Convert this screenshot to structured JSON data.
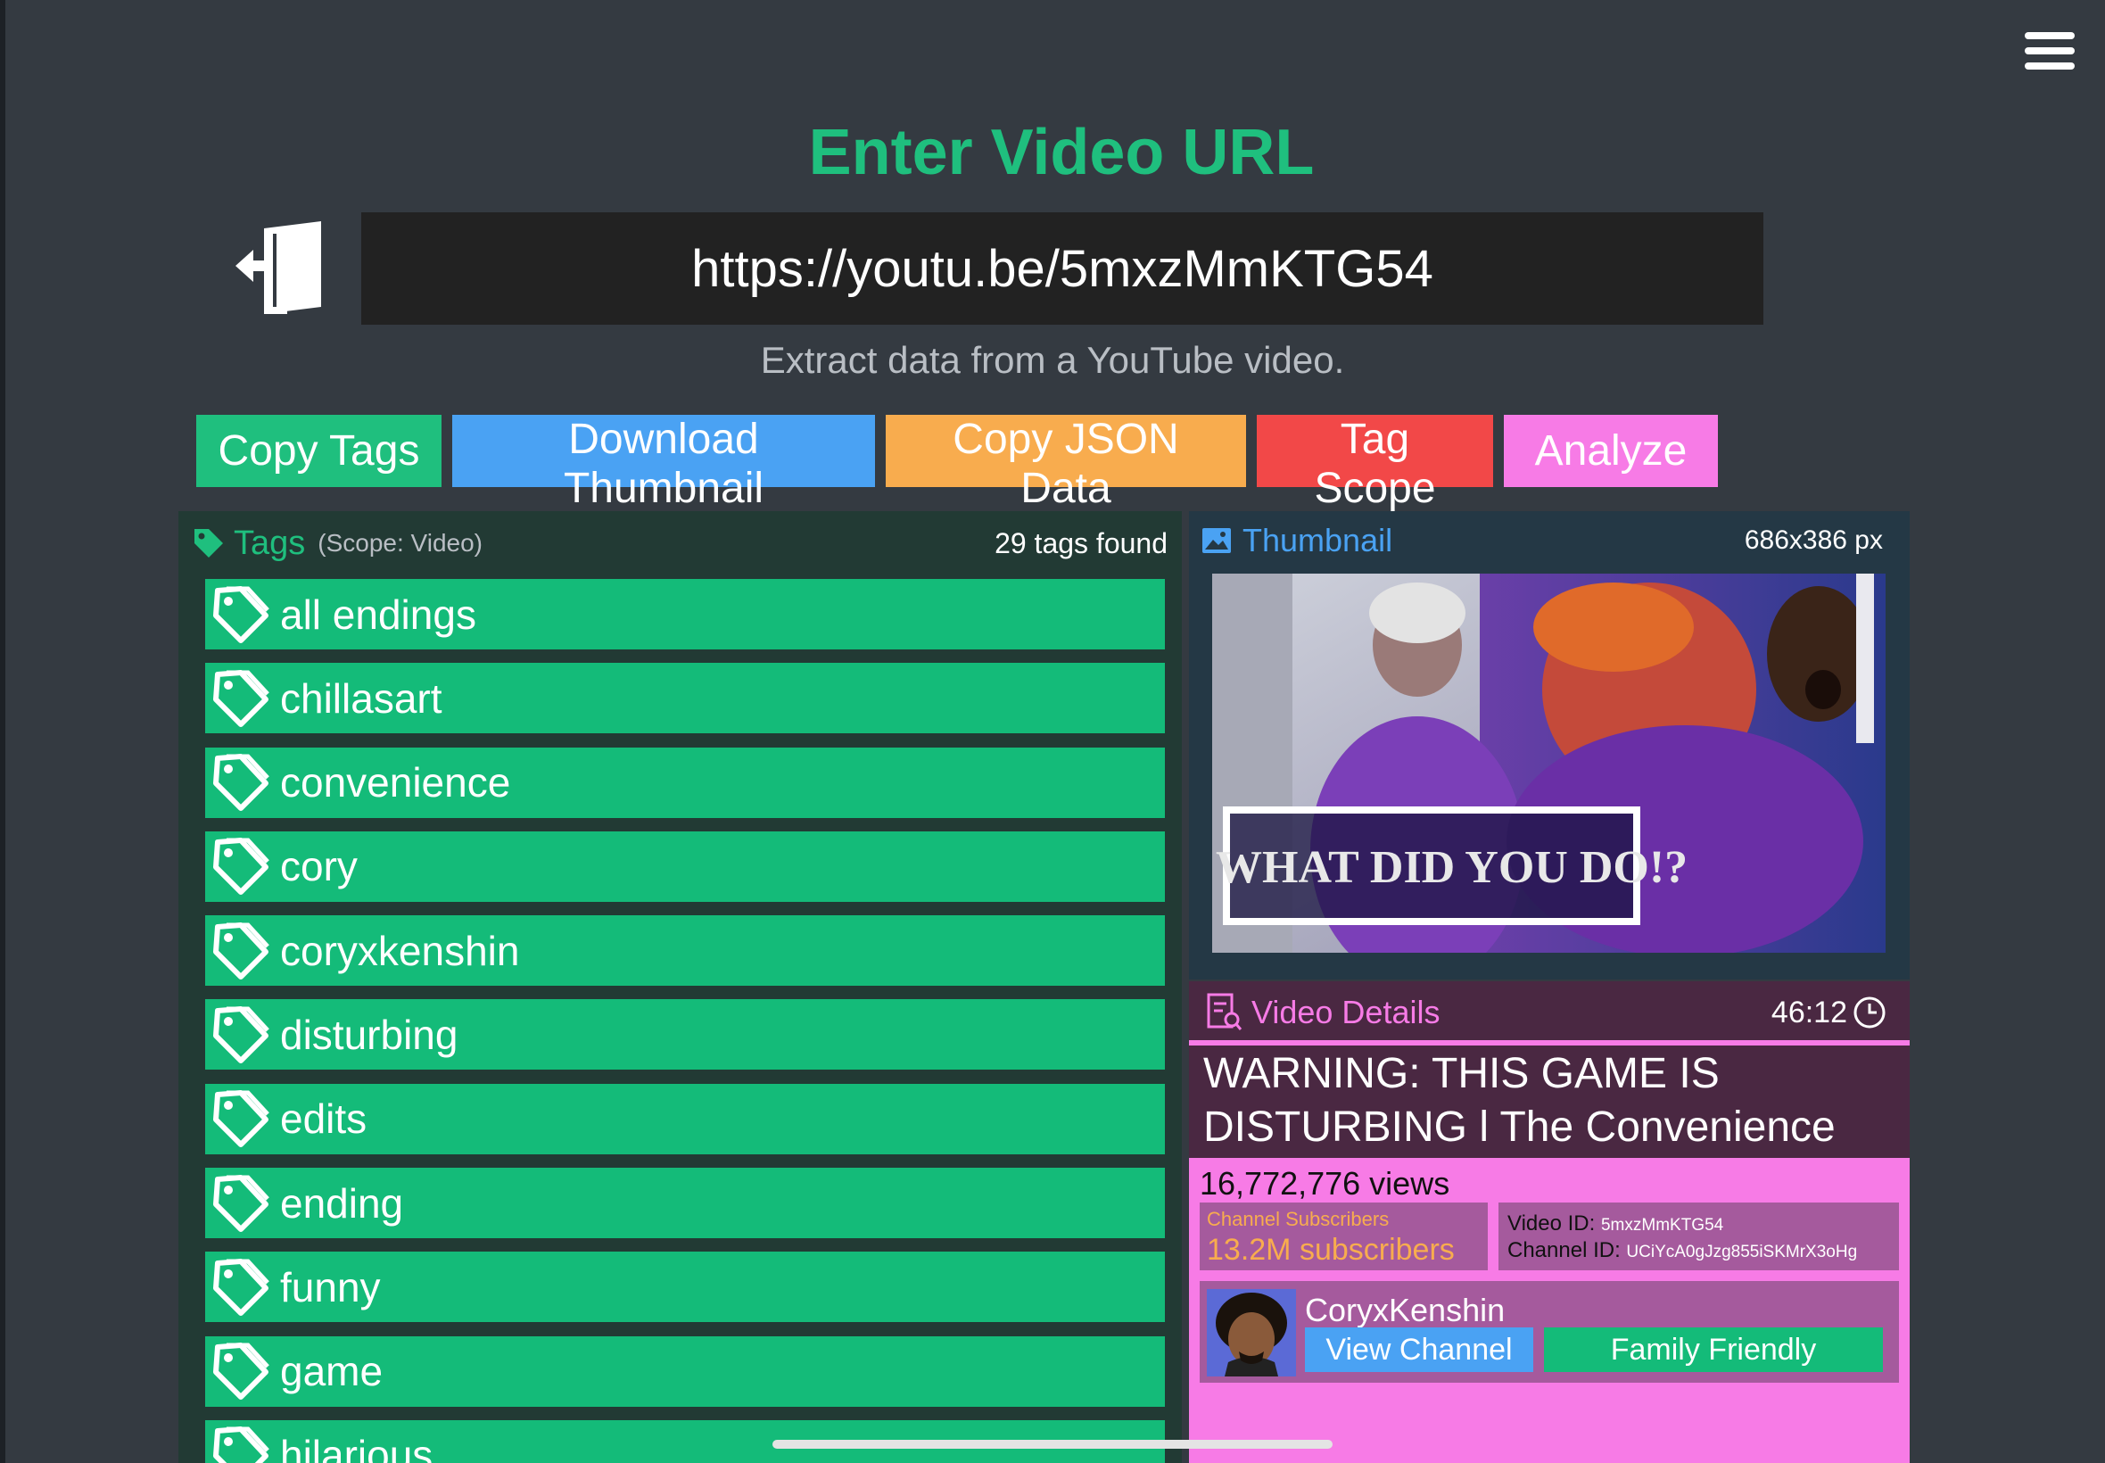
{
  "heading": "Enter Video URL",
  "url_input": {
    "value": "https://youtu.be/5mxzMmKTG54"
  },
  "subtitle": "Extract data from a YouTube video.",
  "buttons": {
    "copy_tags": "Copy Tags",
    "download_thumbnail": "Download Thumbnail",
    "copy_json": "Copy JSON Data",
    "tag_scope": "Tag Scope",
    "analyze": "Analyze"
  },
  "tags_panel": {
    "title": "Tags",
    "scope": "(Scope: Video)",
    "count": "29 tags found",
    "tags": [
      "all endings",
      "chillasart",
      "convenience",
      "cory",
      "coryxkenshin",
      "disturbing",
      "edits",
      "ending",
      "funny",
      "game",
      "hilarious"
    ]
  },
  "thumbnail_panel": {
    "title": "Thumbnail",
    "size": "686x386 px",
    "overlay_text": "WHAT DID YOU DO!?"
  },
  "details_panel": {
    "title": "Video Details",
    "duration": "46:12",
    "video_title": "WARNING: THIS GAME IS DISTURBING l The Convenience",
    "views": "16,772,776 views",
    "subscribers_label": "Channel Subscribers",
    "subscribers_value": "13.2M subscribers",
    "video_id_label": "Video ID:",
    "video_id": "5mxzMmKTG54",
    "channel_id_label": "Channel ID:",
    "channel_id": "UCiYcA0gJzg855iSKMrX3oHg",
    "channel_name": "CoryxKenshin",
    "view_channel": "View Channel",
    "family_friendly": "Family Friendly"
  },
  "colors": {
    "background": "#343a41",
    "green": "#1fbf7e",
    "blue": "#4aa2f3",
    "orange": "#f8ac4e",
    "red": "#f24848",
    "pink": "#f77be6"
  }
}
